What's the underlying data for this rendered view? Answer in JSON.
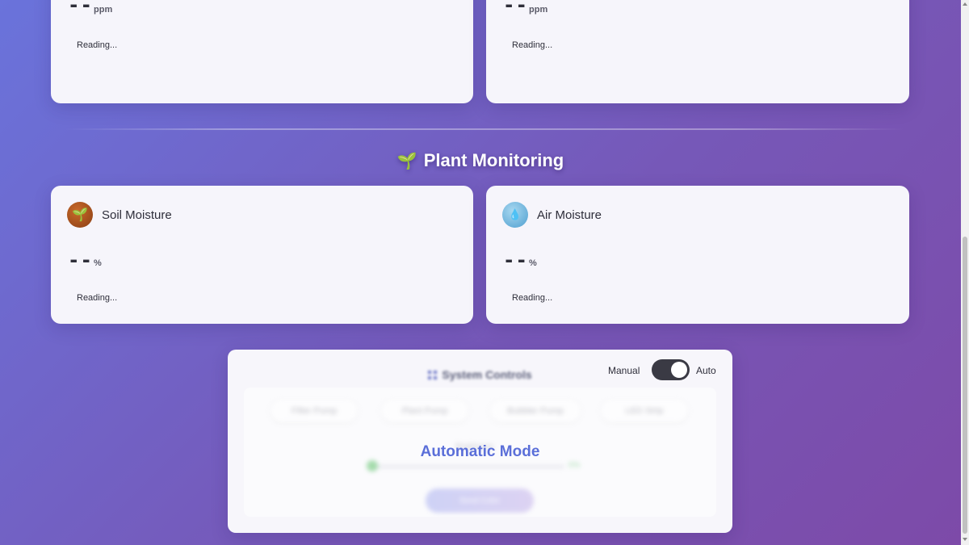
{
  "top_cards": [
    {
      "icon": "green-sensor-icon",
      "icon_color": "#5cb85c",
      "value": "--",
      "unit": "ppm",
      "status": "Reading..."
    },
    {
      "icon": "red-sensor-icon",
      "icon_color": "#e8584d",
      "value": "--",
      "unit": "ppm",
      "status": "Reading..."
    }
  ],
  "plant_section": {
    "heading": "Plant Monitoring",
    "icon": "🌱",
    "cards": [
      {
        "icon": "🌱",
        "icon_name": "seedling-icon",
        "title": "Soil Moisture",
        "value": "--",
        "unit": "%",
        "status": "Reading..."
      },
      {
        "icon": "💧",
        "icon_name": "water-drop-icon",
        "title": "Air Moisture",
        "value": "--",
        "unit": "%",
        "status": "Reading..."
      }
    ]
  },
  "system_controls": {
    "title": "System Controls",
    "mode_manual_label": "Manual",
    "mode_auto_label": "Auto",
    "mode": "Auto",
    "buttons": [
      "Filter Pump",
      "Plant Pump",
      "Bubbler Pump",
      "LED Strip"
    ],
    "slider_caption": "Brightness",
    "slider_value": "0%",
    "slider_fraction": 0,
    "action_button": "Send Color",
    "overlay_text": "Automatic Mode"
  },
  "colors": {
    "accent": "#5b6fd9",
    "background_start": "#6a73db",
    "background_end": "#7d4aa8",
    "slider_green": "#5ec26a"
  }
}
